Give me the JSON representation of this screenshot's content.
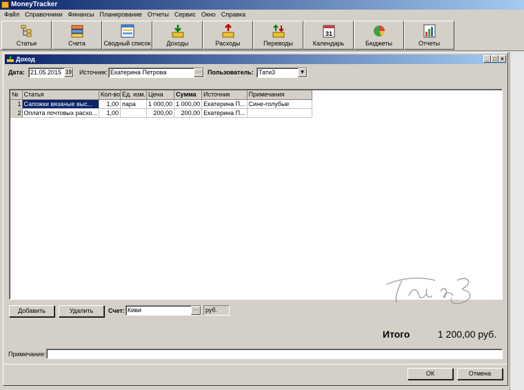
{
  "app": {
    "title": "MoneyTracker"
  },
  "menu": [
    "Файл",
    "Справочники",
    "Финансы",
    "Планирование",
    "Отчеты",
    "Сервис",
    "Окно",
    "Справка"
  ],
  "toolbar": [
    {
      "label": "Статьи",
      "icon": "tree-icon"
    },
    {
      "label": "Счета",
      "icon": "cards-icon"
    },
    {
      "label": "Сводный список",
      "icon": "list-icon"
    },
    {
      "label": "Доходы",
      "icon": "income-icon"
    },
    {
      "label": "Расходы",
      "icon": "expense-icon"
    },
    {
      "label": "Переводы",
      "icon": "transfer-icon"
    },
    {
      "label": "Календарь",
      "icon": "calendar-icon"
    },
    {
      "label": "Бюджеты",
      "icon": "pie-icon"
    },
    {
      "label": "Отчеты",
      "icon": "bar-chart-icon"
    }
  ],
  "calendar_day": "31",
  "window": {
    "title": "Доход"
  },
  "form": {
    "date_label": "Дата:",
    "date_value": "21.05.2015",
    "date_btn": "19",
    "source_label": "Источник:",
    "source_value": "Екатерина Петрова",
    "ellipsis": "···",
    "user_label": "Пользователь:",
    "user_value": "Тати3",
    "account_label": "Счет:",
    "account_value": "Киви",
    "currency": "руб.",
    "note_label": "Примечание:",
    "note_value": ""
  },
  "table": {
    "columns": [
      "№",
      "Статья",
      "Кол-во",
      "Ед. изм.",
      "Цена",
      "Сумма",
      "Источник",
      "Примечания"
    ],
    "rows": [
      {
        "n": "1",
        "item": "Сапожки вязаные выс...",
        "qty": "1,00",
        "unit": "пара",
        "price": "1 000,00",
        "sum": "1 000,00",
        "source": "Екатерина П...",
        "note": "Сине-голубые"
      },
      {
        "n": "2",
        "item": "Оплата почтовых расхо...",
        "qty": "1,00",
        "unit": "",
        "price": "200,00",
        "sum": "200,00",
        "source": "Екатерина П...",
        "note": ""
      }
    ]
  },
  "buttons": {
    "add": "Добавить",
    "delete": "Удалить",
    "ok": "ОК",
    "cancel": "Отмена"
  },
  "total": {
    "label": "Итого",
    "value": "1 200,00 руб."
  },
  "watermark": "Тати3"
}
